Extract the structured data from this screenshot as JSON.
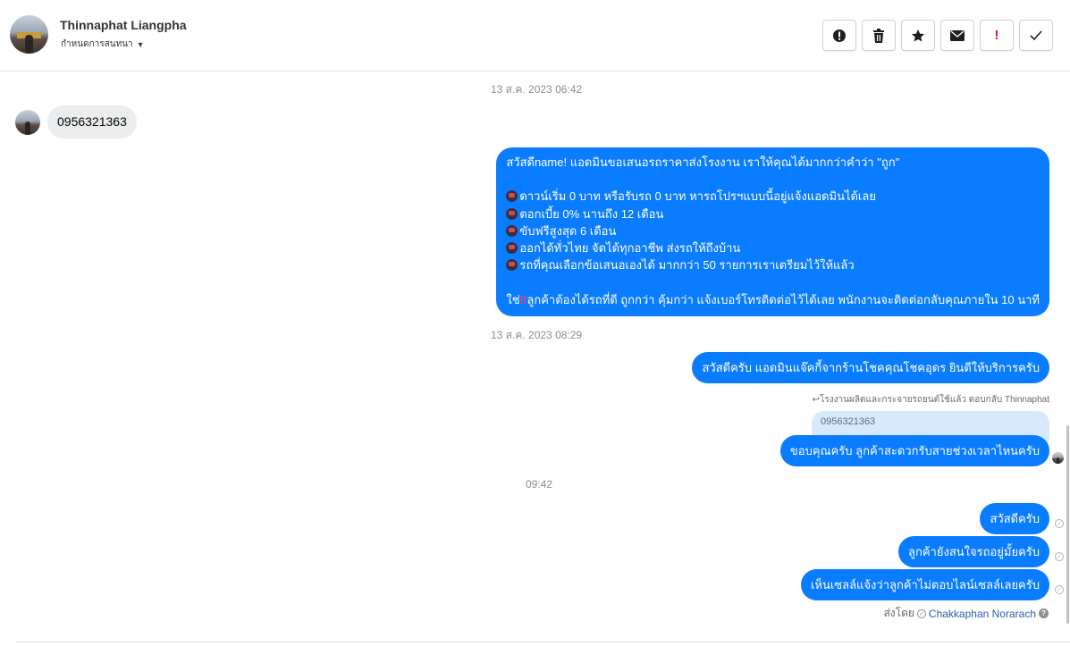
{
  "header": {
    "name": "Thinnaphat Liangpha",
    "subtitle": "กำหนดการสนทนา",
    "actions": [
      "spam-icon",
      "trash-icon",
      "star-icon",
      "envelope-icon",
      "important-icon",
      "check-icon"
    ],
    "important_glyph": "!"
  },
  "timestamps": {
    "t1": "13 ส.ค. 2023 06:42",
    "t2": "13 ส.ค. 2023 08:29",
    "t3": "09:42"
  },
  "messages": {
    "incoming_phone": "0956321363",
    "promo": {
      "line1": "สวัสดีname! แอดมินขอเสนอรถราคาส่งโรงงาน เราให้คุณได้มากกว่าคำว่า \"ถูก\"",
      "bullet1": "ดาวน์เริ่ม 0 บาท หรือรับรถ 0 บาท หารถโปรฯแบบนี้อยู่แจ้งแอดมินได้เลย",
      "bullet2": "ดอกเบี้ย 0% นานถึง 12 เดือน",
      "bullet3": "ขับฟรีสูงสุด 6 เดือน",
      "bullet4": "ออกได้ทั่วไทย จัดได้ทุกอาชีพ ส่งรถให้ถึงบ้าน",
      "bullet5": "รถที่คุณเลือกข้อเสนอเองได้ มากกว่า 50 รายการเราเตรียมไว้ให้แล้ว",
      "closing_prefix": "ใช่",
      "closing_mark": "‼",
      "closing": "ลูกค้าต้องได้รถที่ดี ถูกกว่า คุ้มกว่า แจ้งเบอร์โทรติดต่อไว้ได้เลย พนักงานจะติดต่อกลับคุณภายใน 10 นาที"
    },
    "greeting": "สวัสดีครับ แอดมินแจ๊คกี้จากร้านโชคคุณโชคอุดร ยินดีให้บริการครับ",
    "reply_label": "โรงงานผลิตและกระจายรถยนต์ใช้แล้ว ตอบกลับ Thinnaphat",
    "quoted": "0956321363",
    "reply": "ขอบคุณครับ ลูกค้าสะดวกรับสายช่วงเวลาไหนครับ",
    "followup1": "สวัสดีครับ",
    "followup2": "ลูกค้ายังสนใจรถอยู่มั้ยครับ",
    "followup3": "เห็นเซลล์แจ้งว่าลูกค้าไม่ตอบไลน์เซลล์เลยครับ"
  },
  "sent_by": {
    "label": "ส่งโดย",
    "name": "Chakkaphan Norarach",
    "help": "?"
  },
  "colors": {
    "outgoing": "#0a7cff",
    "incoming": "#eaecee"
  }
}
